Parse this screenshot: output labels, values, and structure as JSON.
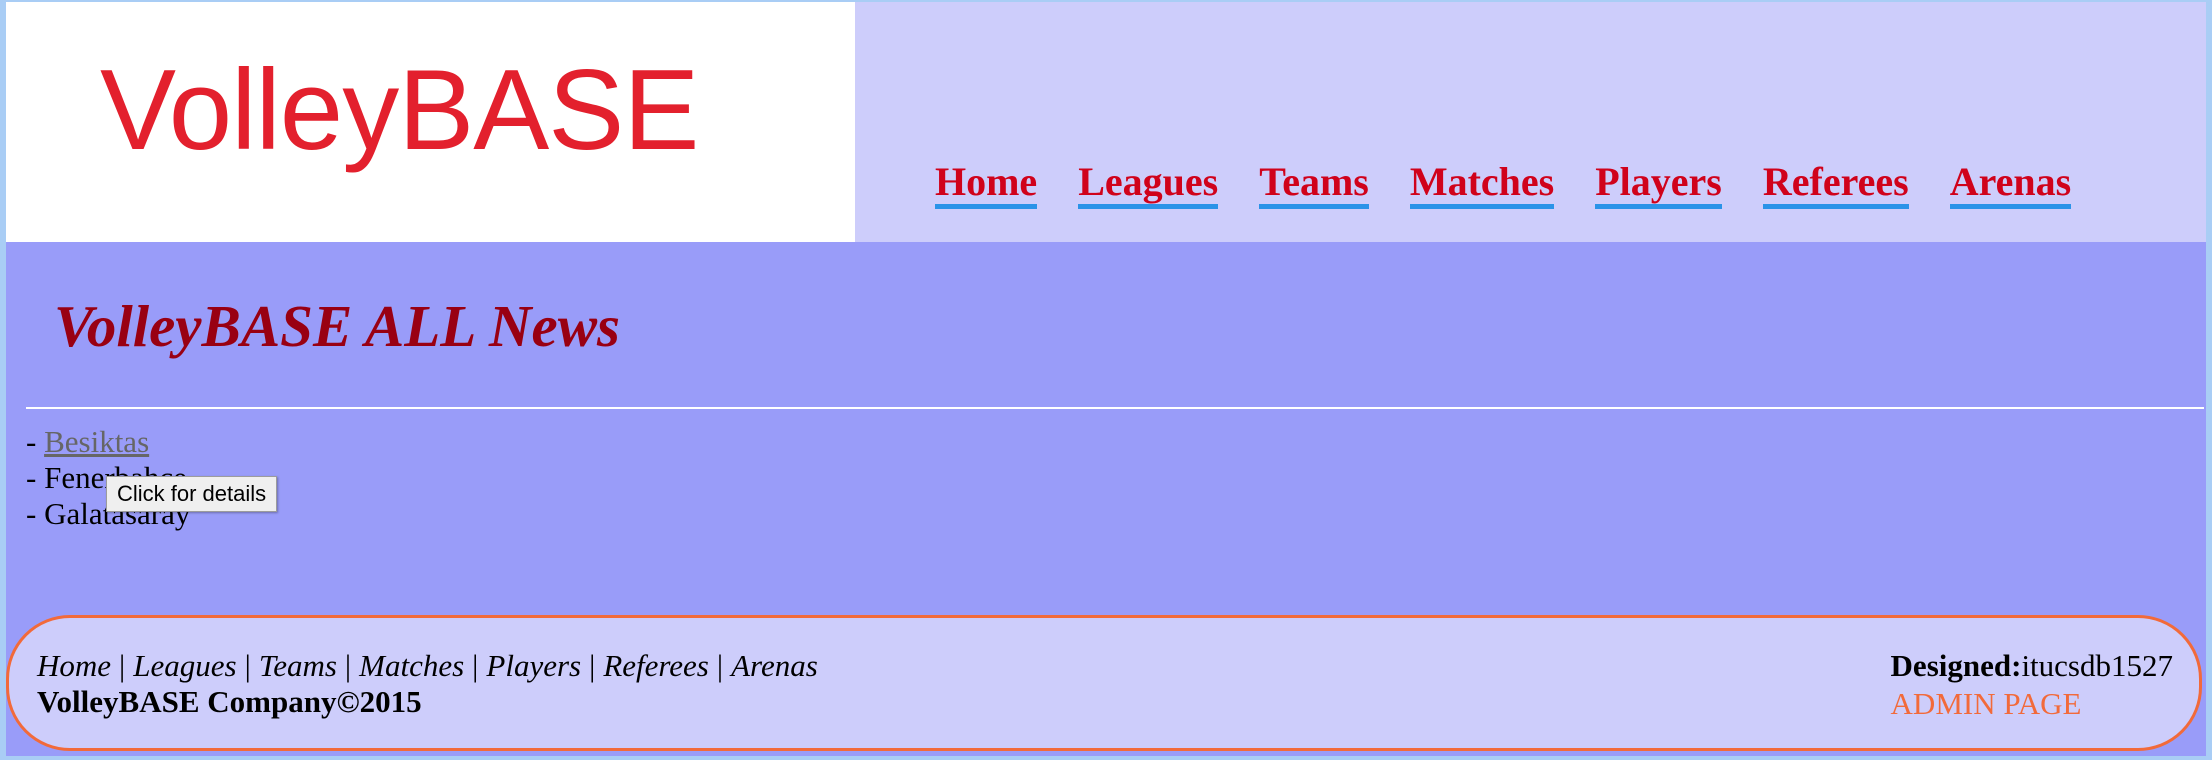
{
  "logo": {
    "text": "VolleyBASE"
  },
  "nav": {
    "items": [
      "Home",
      "Leagues",
      "Teams",
      "Matches",
      "Players",
      "Referees",
      "Arenas"
    ]
  },
  "main": {
    "title": "VolleyBASE ALL News",
    "news": [
      {
        "prefix": "- ",
        "label": "Besiktas"
      },
      {
        "prefix": "- ",
        "label": "Fenerbahce"
      },
      {
        "prefix": "- ",
        "label": "Galatasaray"
      }
    ],
    "tooltip": "Click for details"
  },
  "footer": {
    "links": [
      "Home",
      "Leagues",
      "Teams",
      "Matches",
      "Players",
      "Referees",
      "Arenas"
    ],
    "separator": "|",
    "copyright": "VolleyBASE Company©2015",
    "designed_label": "Designed:",
    "designed_value": "itucsdb1527",
    "admin_link": "ADMIN PAGE"
  },
  "colors": {
    "page_background": "#999cf9",
    "header_background": "#cdcdfb",
    "nav_text": "#d0021b",
    "nav_underline": "#2a93e8",
    "title_text": "#990012",
    "footer_border": "#f26a3a",
    "admin_link": "#f26a3a"
  }
}
